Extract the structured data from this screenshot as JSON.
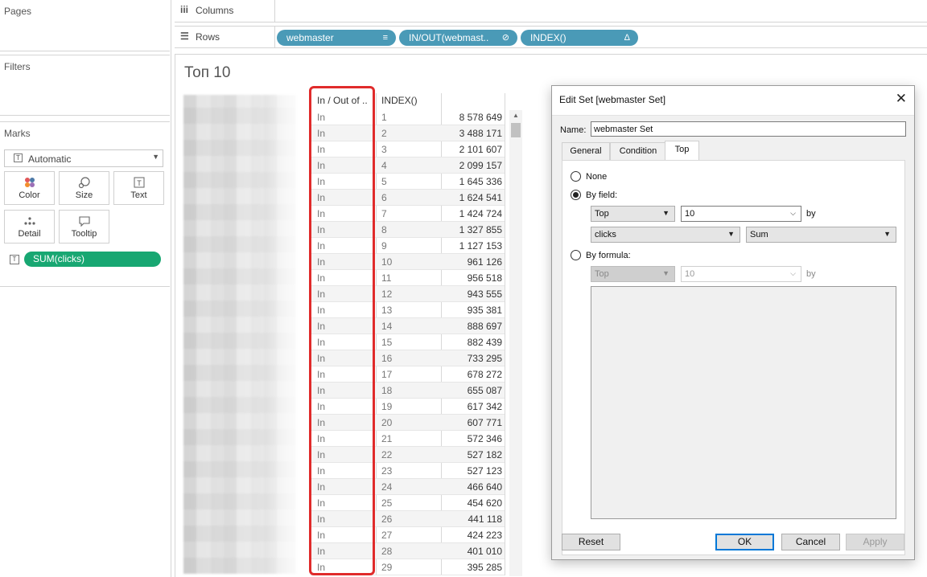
{
  "left": {
    "pages_title": "Pages",
    "filters_title": "Filters",
    "marks_title": "Marks",
    "mark_type": "Automatic",
    "mark_buttons": [
      "Color",
      "Size",
      "Text",
      "Detail",
      "Tooltip"
    ],
    "mark_pill": "SUM(clicks)"
  },
  "shelves": {
    "columns_label": "Columns",
    "rows_label": "Rows",
    "row_pills": [
      "webmaster",
      "IN/OUT(webmast..",
      "INDEX()"
    ]
  },
  "view": {
    "title": "Топ 10",
    "col_headers": [
      "In / Out of ..",
      "INDEX()"
    ],
    "rows": [
      {
        "inout": "In",
        "index": "1",
        "clicks": "8 578 649"
      },
      {
        "inout": "In",
        "index": "2",
        "clicks": "3 488 171"
      },
      {
        "inout": "In",
        "index": "3",
        "clicks": "2 101 607"
      },
      {
        "inout": "In",
        "index": "4",
        "clicks": "2 099 157"
      },
      {
        "inout": "In",
        "index": "5",
        "clicks": "1 645 336"
      },
      {
        "inout": "In",
        "index": "6",
        "clicks": "1 624 541"
      },
      {
        "inout": "In",
        "index": "7",
        "clicks": "1 424 724"
      },
      {
        "inout": "In",
        "index": "8",
        "clicks": "1 327 855"
      },
      {
        "inout": "In",
        "index": "9",
        "clicks": "1 127 153"
      },
      {
        "inout": "In",
        "index": "10",
        "clicks": "961 126"
      },
      {
        "inout": "In",
        "index": "11",
        "clicks": "956 518"
      },
      {
        "inout": "In",
        "index": "12",
        "clicks": "943 555"
      },
      {
        "inout": "In",
        "index": "13",
        "clicks": "935 381"
      },
      {
        "inout": "In",
        "index": "14",
        "clicks": "888 697"
      },
      {
        "inout": "In",
        "index": "15",
        "clicks": "882 439"
      },
      {
        "inout": "In",
        "index": "16",
        "clicks": "733 295"
      },
      {
        "inout": "In",
        "index": "17",
        "clicks": "678 272"
      },
      {
        "inout": "In",
        "index": "18",
        "clicks": "655 087"
      },
      {
        "inout": "In",
        "index": "19",
        "clicks": "617 342"
      },
      {
        "inout": "In",
        "index": "20",
        "clicks": "607 771"
      },
      {
        "inout": "In",
        "index": "21",
        "clicks": "572 346"
      },
      {
        "inout": "In",
        "index": "22",
        "clicks": "527 182"
      },
      {
        "inout": "In",
        "index": "23",
        "clicks": "527 123"
      },
      {
        "inout": "In",
        "index": "24",
        "clicks": "466 640"
      },
      {
        "inout": "In",
        "index": "25",
        "clicks": "454 620"
      },
      {
        "inout": "In",
        "index": "26",
        "clicks": "441 118"
      },
      {
        "inout": "In",
        "index": "27",
        "clicks": "424 223"
      },
      {
        "inout": "In",
        "index": "28",
        "clicks": "401 010"
      },
      {
        "inout": "In",
        "index": "29",
        "clicks": "395 285"
      }
    ]
  },
  "dialog": {
    "title": "Edit Set [webmaster Set]",
    "name_label": "Name:",
    "name_value": "webmaster Set",
    "tabs": [
      "General",
      "Condition",
      "Top"
    ],
    "active_tab": "Top",
    "none_label": "None",
    "by_field_label": "By field:",
    "by_formula_label": "By formula:",
    "field_top": "Top",
    "field_count": "10",
    "by_word": "by",
    "field_name": "clicks",
    "field_agg": "Sum",
    "formula_top": "Top",
    "formula_count": "10",
    "buttons": {
      "reset": "Reset",
      "ok": "OK",
      "cancel": "Cancel",
      "apply": "Apply"
    }
  },
  "colors": {
    "green_pill": "#18a772",
    "blue_pill": "#4a9ab7",
    "highlight": "#e02b2b",
    "ok_border": "#0078d7"
  }
}
